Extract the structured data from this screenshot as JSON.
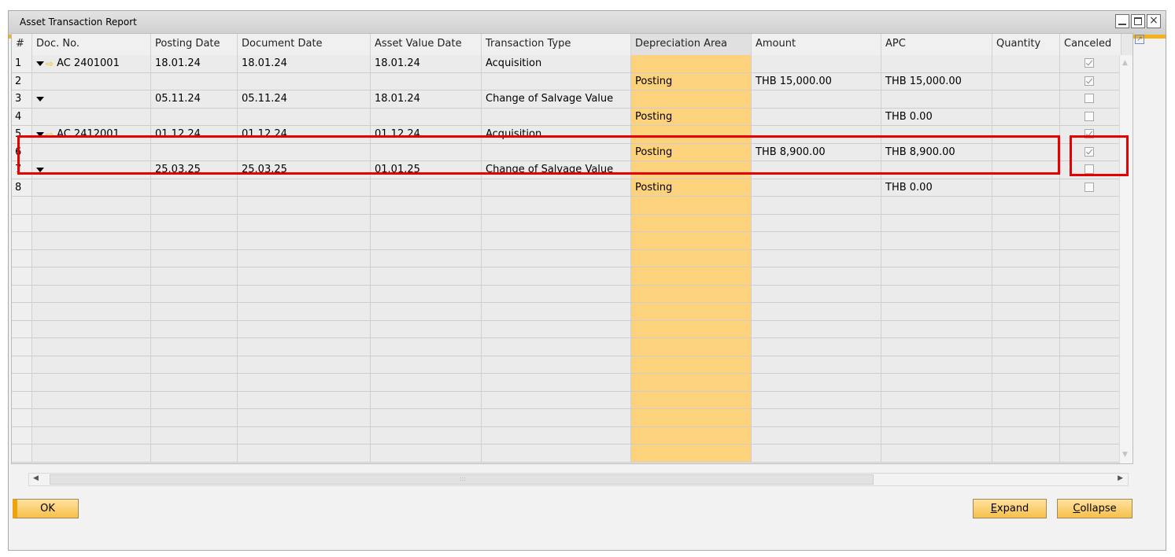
{
  "window": {
    "title": "Asset Transaction Report",
    "controls": {
      "minimize": "minimize-icon",
      "maximize": "maximize-icon",
      "close": "×"
    }
  },
  "grid": {
    "columns": [
      {
        "key": "num",
        "label": "#"
      },
      {
        "key": "doc",
        "label": "Doc. No."
      },
      {
        "key": "posting",
        "label": "Posting Date"
      },
      {
        "key": "document",
        "label": "Document Date"
      },
      {
        "key": "assetvalue",
        "label": "Asset Value Date"
      },
      {
        "key": "ttype",
        "label": "Transaction Type"
      },
      {
        "key": "deparea",
        "label": "Depreciation Area"
      },
      {
        "key": "amount",
        "label": "Amount"
      },
      {
        "key": "apc",
        "label": "APC"
      },
      {
        "key": "qty",
        "label": "Quantity"
      },
      {
        "key": "canceled",
        "label": "Canceled"
      }
    ],
    "rows": [
      {
        "num": "1",
        "expand": true,
        "link": true,
        "doc": "AC 2401001",
        "posting": "18.01.24",
        "document": "18.01.24",
        "assetvalue": "18.01.24",
        "ttype": "Acquisition",
        "deparea": "",
        "amount": "",
        "apc": "",
        "qty": "",
        "canceled": true
      },
      {
        "num": "2",
        "expand": false,
        "link": false,
        "doc": "",
        "posting": "",
        "document": "",
        "assetvalue": "",
        "ttype": "",
        "deparea": "Posting",
        "amount": "THB 15,000.00",
        "apc": "THB 15,000.00",
        "qty": "",
        "canceled": true
      },
      {
        "num": "3",
        "expand": true,
        "link": false,
        "doc": "",
        "posting": "05.11.24",
        "document": "05.11.24",
        "assetvalue": "18.01.24",
        "ttype": "Change of Salvage Value",
        "deparea": "",
        "amount": "",
        "apc": "",
        "qty": "",
        "canceled": false
      },
      {
        "num": "4",
        "expand": false,
        "link": false,
        "doc": "",
        "posting": "",
        "document": "",
        "assetvalue": "",
        "ttype": "",
        "deparea": "Posting",
        "amount": "",
        "apc": "THB 0.00",
        "qty": "",
        "canceled": false
      },
      {
        "num": "5",
        "expand": true,
        "link": true,
        "doc": "AC 2412001",
        "posting": "01.12.24",
        "document": "01.12.24",
        "assetvalue": "01.12.24",
        "ttype": "Acquisition",
        "deparea": "",
        "amount": "",
        "apc": "",
        "qty": "",
        "canceled": true
      },
      {
        "num": "6",
        "expand": false,
        "link": false,
        "doc": "",
        "posting": "",
        "document": "",
        "assetvalue": "",
        "ttype": "",
        "deparea": "Posting",
        "amount": "THB 8,900.00",
        "apc": "THB 8,900.00",
        "qty": "",
        "canceled": true
      },
      {
        "num": "7",
        "expand": true,
        "link": false,
        "doc": "",
        "posting": "25.03.25",
        "document": "25.03.25",
        "assetvalue": "01.01.25",
        "ttype": "Change of Salvage Value",
        "deparea": "",
        "amount": "",
        "apc": "",
        "qty": "",
        "canceled": false
      },
      {
        "num": "8",
        "expand": false,
        "link": false,
        "doc": "",
        "posting": "",
        "document": "",
        "assetvalue": "",
        "ttype": "",
        "deparea": "Posting",
        "amount": "",
        "apc": "THB 0.00",
        "qty": "",
        "canceled": false
      }
    ],
    "empty_rows": 15
  },
  "buttons": {
    "ok": "OK",
    "expand_u": "E",
    "expand_rest": "xpand",
    "collapse_u": "C",
    "collapse_rest": "ollapse"
  },
  "colors": {
    "accent": "#f6b01e",
    "highlight_column": "#fcd27d",
    "annotation": "#e60000"
  }
}
